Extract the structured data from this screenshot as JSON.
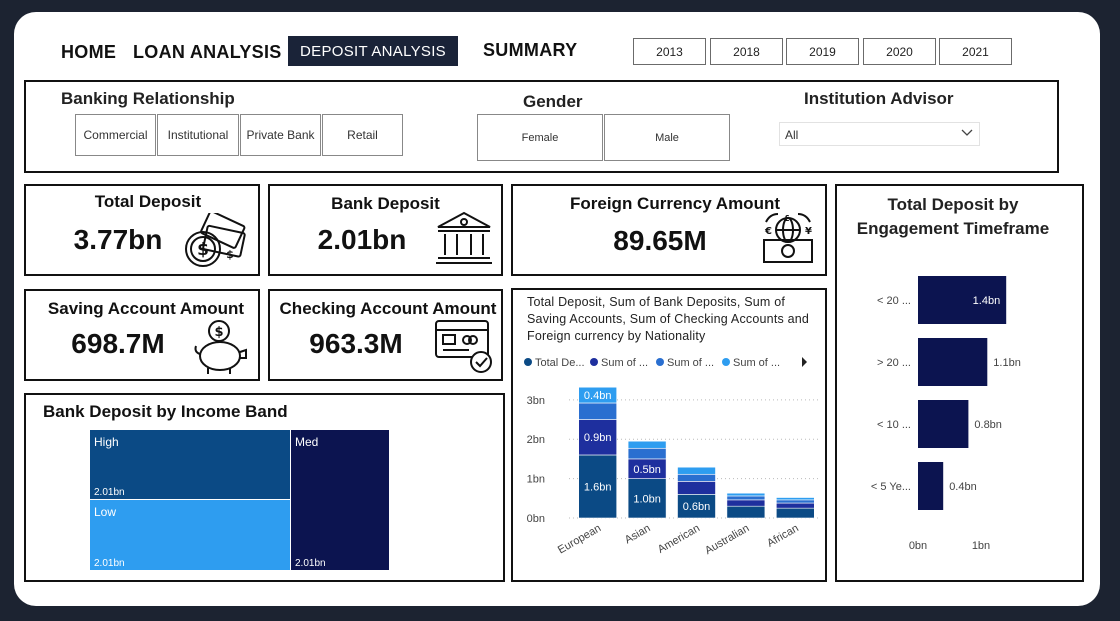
{
  "nav": {
    "home": "HOME",
    "loan": "LOAN ANALYSIS",
    "deposit": "DEPOSIT ANALYSIS",
    "summary": "SUMMARY"
  },
  "years": [
    "2013",
    "2018",
    "2019",
    "2020",
    "2021"
  ],
  "filters": {
    "banking_title": "Banking Relationship",
    "banking_options": [
      "Commercial",
      "Institutional",
      "Private Bank",
      "Retail"
    ],
    "gender_title": "Gender",
    "gender_options": [
      "Female",
      "Male"
    ],
    "advisor_title": "Institution Advisor",
    "advisor_value": "All"
  },
  "kpis": {
    "total_deposit_label": "Total Deposit",
    "total_deposit_value": "3.77bn",
    "bank_deposit_label": "Bank Deposit",
    "bank_deposit_value": "2.01bn",
    "foreign_label": "Foreign Currency Amount",
    "foreign_value": "89.65M",
    "saving_label": "Saving Account Amount",
    "saving_value": "698.7M",
    "checking_label": "Checking Account Amount",
    "checking_value": "963.3M"
  },
  "icons": {
    "total_deposit": "money-icon",
    "bank_deposit": "bank-icon",
    "foreign": "globe-currency-icon",
    "saving": "piggy-bank-icon",
    "checking": "card-check-icon"
  },
  "colors": {
    "navy": "#0c1450",
    "darkblue": "#0b4a85",
    "royal": "#1e2f9e",
    "mid": "#2a6fd0",
    "light": "#2e9df0",
    "header_bg": "#1a2338"
  },
  "treemap": {
    "title": "Bank Deposit by Income Band",
    "cells": [
      {
        "label": "High",
        "value_text": "2.01bn",
        "color": "#0b4a85"
      },
      {
        "label": "Low",
        "value_text": "2.01bn",
        "color": "#2e9df0"
      },
      {
        "label": "Med",
        "value_text": "2.01bn",
        "color": "#0c1450"
      }
    ]
  },
  "chart_data": [
    {
      "type": "bar",
      "stacked": true,
      "title": "Total Deposit, Sum of Bank Deposits, Sum of Saving Accounts, Sum of Checking Accounts and Foreign currency by Nationality",
      "legend": [
        "Total De...",
        "Sum of ...",
        "Sum of ...",
        "Sum of ..."
      ],
      "legend_colors": [
        "#0b4a85",
        "#1e2f9e",
        "#2a6fd0",
        "#2e9df0"
      ],
      "categories": [
        "European",
        "Asian",
        "American",
        "Australian",
        "African"
      ],
      "series": [
        {
          "name": "Total De...",
          "values": [
            1.6,
            1.0,
            0.6,
            0.3,
            0.25
          ]
        },
        {
          "name": "Sum of ...",
          "values": [
            0.9,
            0.5,
            0.33,
            0.16,
            0.13
          ]
        },
        {
          "name": "Sum of ...",
          "values": [
            0.42,
            0.27,
            0.18,
            0.1,
            0.08
          ]
        },
        {
          "name": "Sum of ...",
          "values": [
            0.4,
            0.18,
            0.18,
            0.07,
            0.06
          ]
        }
      ],
      "data_labels": [
        {
          "cat": "European",
          "series": 0,
          "text": "1.6bn"
        },
        {
          "cat": "European",
          "series": 1,
          "text": "0.9bn"
        },
        {
          "cat": "European",
          "series": 3,
          "text": "0.4bn"
        },
        {
          "cat": "Asian",
          "series": 0,
          "text": "1.0bn"
        },
        {
          "cat": "Asian",
          "series": 1,
          "text": "0.5bn"
        },
        {
          "cat": "American",
          "series": 0,
          "text": "0.6bn"
        }
      ],
      "yticks": [
        "0bn",
        "1bn",
        "2bn",
        "3bn"
      ],
      "ylim": [
        0,
        3.3
      ]
    },
    {
      "type": "bar",
      "orientation": "horizontal",
      "title": "Total Deposit by Engagement Timeframe",
      "categories": [
        "< 20 ...",
        "> 20 ...",
        "< 10 ...",
        "< 5 Ye..."
      ],
      "values": [
        1.4,
        1.1,
        0.8,
        0.4
      ],
      "data_labels": [
        "1.4bn",
        "1.1bn",
        "0.8bn",
        "0.4bn"
      ],
      "xticks": [
        "0bn",
        "1bn"
      ],
      "xlim": [
        0,
        1.6
      ]
    }
  ]
}
